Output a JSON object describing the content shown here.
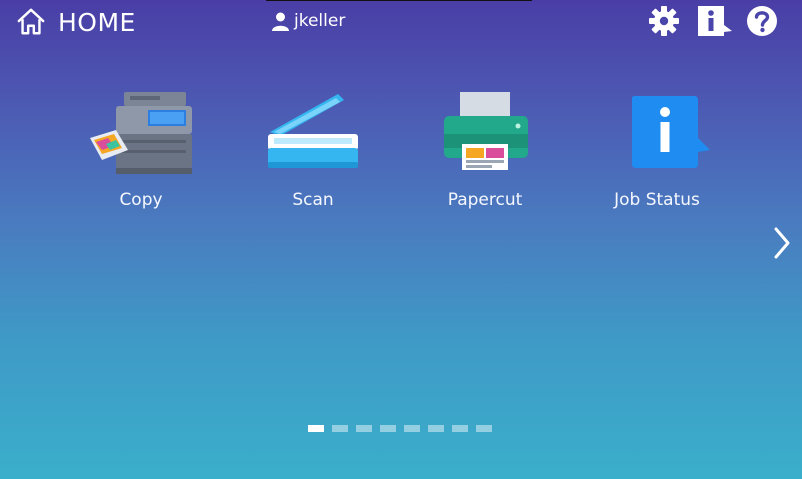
{
  "header": {
    "home_label": "HOME",
    "username": "jkeller",
    "icons": [
      "home-icon",
      "user-icon",
      "gear-icon",
      "info-icon",
      "help-icon"
    ]
  },
  "apps": [
    {
      "label": "Copy",
      "icon": "copier-icon"
    },
    {
      "label": "Scan",
      "icon": "scanner-icon"
    },
    {
      "label": "Papercut",
      "icon": "printer-icon"
    },
    {
      "label": "Job Status",
      "icon": "info-icon"
    }
  ],
  "pagination": {
    "total_pages": 8,
    "current_page": 1
  },
  "colors": {
    "bg_top": "#4a3ea6",
    "bg_bottom": "#3aafcb",
    "scan_blue": "#35b6f0",
    "papercut_green": "#22a98c",
    "job_status_blue": "#1e8cf0"
  }
}
